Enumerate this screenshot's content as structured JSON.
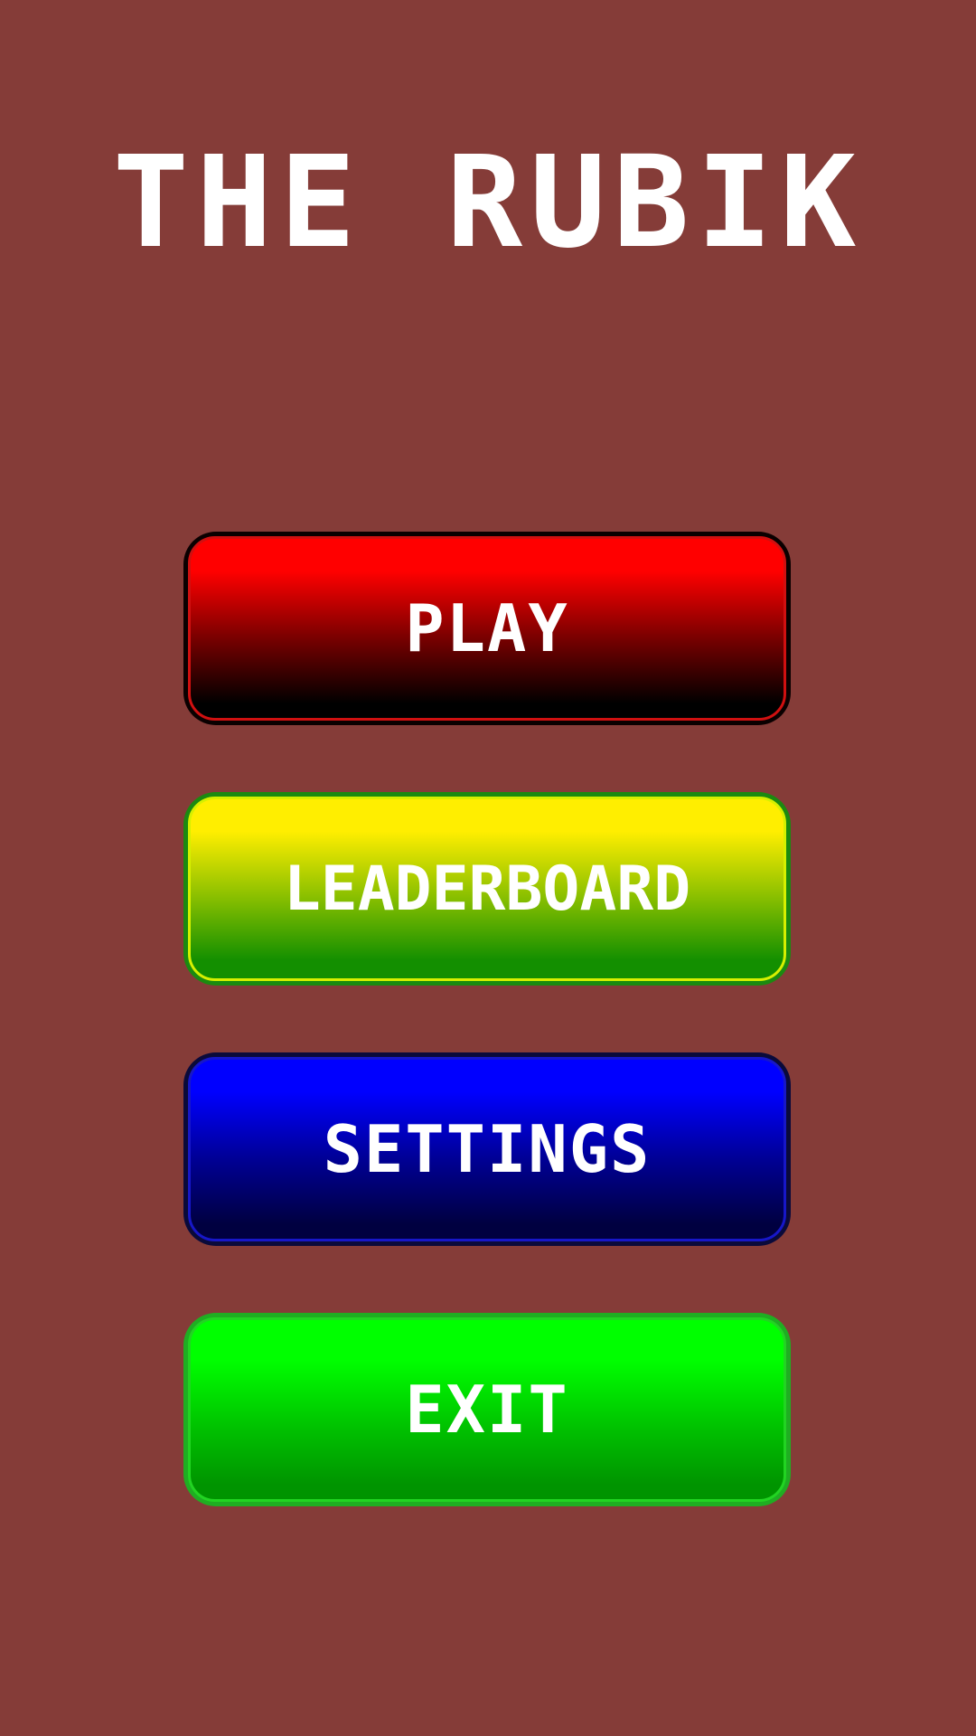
{
  "title": "THE RUBIK",
  "menu": {
    "play_label": "PLAY",
    "leaderboard_label": "LEADERBOARD",
    "settings_label": "SETTINGS",
    "exit_label": "EXIT"
  },
  "colors": {
    "background": "#853c38",
    "play": "#ff0000",
    "leaderboard": "#ffee00",
    "settings": "#0000ff",
    "exit": "#00ff00",
    "text": "#ffffff"
  }
}
